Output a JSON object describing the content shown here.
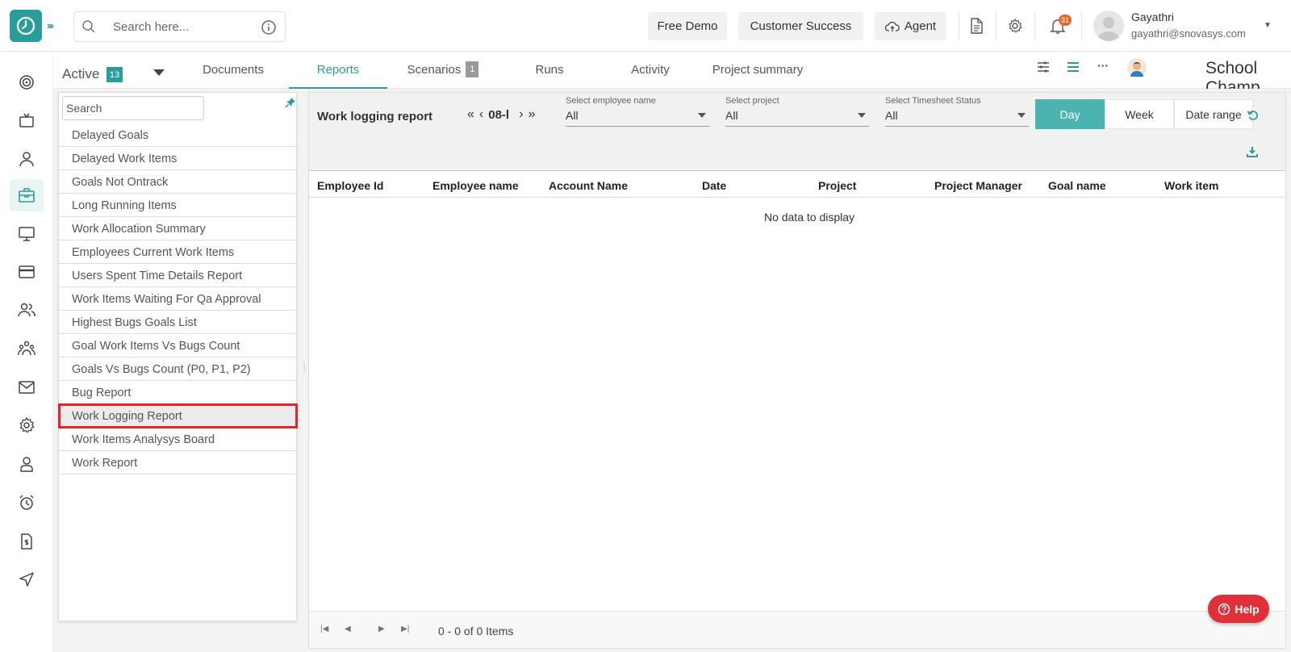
{
  "header": {
    "search_placeholder": "Search here...",
    "free_demo": "Free Demo",
    "customer_success": "Customer Success",
    "agent": "Agent",
    "notification_count": "31",
    "user_name": "Gayathri",
    "user_email": "gayathri@snovasys.com"
  },
  "tabbar": {
    "active_label": "Active",
    "active_count": "13",
    "tabs": [
      {
        "label": "Documents"
      },
      {
        "label": "Reports"
      },
      {
        "label": "Scenarios",
        "count": "1"
      },
      {
        "label": "Runs"
      },
      {
        "label": "Activity"
      },
      {
        "label": "Project summary"
      }
    ],
    "project_name": "School Champ"
  },
  "reports_panel": {
    "search_placeholder": "Search",
    "items": [
      "Delayed Goals",
      "Delayed Work Items",
      "Goals Not Ontrack",
      "Long Running Items",
      "Work Allocation Summary",
      "Employees Current Work Items",
      "Users Spent Time Details Report",
      "Work Items Waiting For Qa Approval",
      "Highest Bugs Goals List",
      "Goal Work Items Vs Bugs Count",
      "Goals Vs Bugs Count (P0, P1, P2)",
      "Bug Report",
      "Work Logging Report",
      "Work Items Analysys Board",
      "Work Report"
    ],
    "selected": "Work Logging Report"
  },
  "report": {
    "title": "Work logging report",
    "date_label": "08-l",
    "filters": [
      {
        "label": "Select employee name",
        "value": "All"
      },
      {
        "label": "Select project",
        "value": "All"
      },
      {
        "label": "Select Timesheet Status",
        "value": "All"
      }
    ],
    "view_modes": [
      "Day",
      "Week",
      "Date range"
    ],
    "active_view": "Day",
    "columns": [
      "Employee Id",
      "Employee name",
      "Account Name",
      "Date",
      "Project",
      "Project Manager",
      "Goal name",
      "Work item"
    ],
    "empty_message": "No data to display",
    "pager_info": "0 - 0 of 0 Items"
  },
  "help_label": "Help",
  "colors": {
    "accent": "#2a9d9a",
    "day_button": "#4bb3b0",
    "help": "#e0303a",
    "selection_outline": "#e0262c",
    "notification": "#e8672c"
  }
}
